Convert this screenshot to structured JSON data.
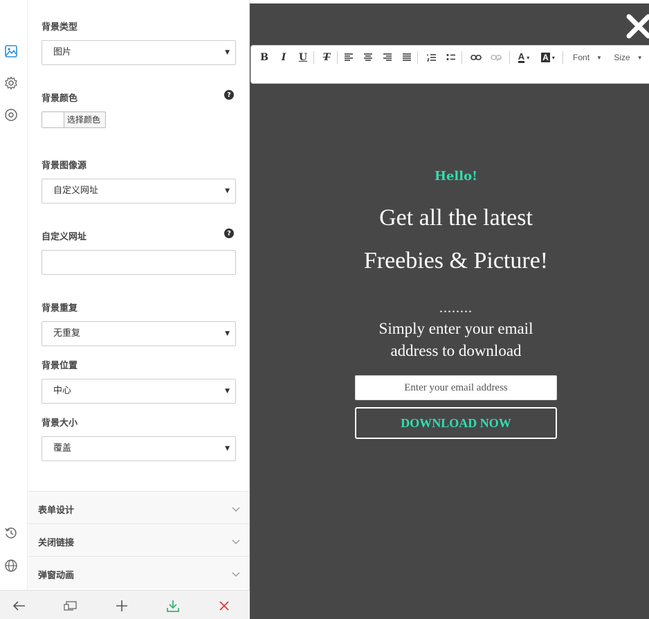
{
  "panel": {
    "bg_type": {
      "label": "背景类型",
      "value": "图片"
    },
    "bg_color": {
      "label": "背景颜色",
      "picker_label": "选择颜色",
      "help": "?"
    },
    "bg_image_source": {
      "label": "背景图像源",
      "value": "自定义网址"
    },
    "custom_url": {
      "label": "自定义网址",
      "value": "",
      "help": "?"
    },
    "bg_repeat": {
      "label": "背景重复",
      "value": "无重复"
    },
    "bg_position": {
      "label": "背景位置",
      "value": "中心"
    },
    "bg_size": {
      "label": "背景大小",
      "value": "覆盖"
    },
    "sections": [
      {
        "title": "表单设计"
      },
      {
        "title": "关闭链接"
      },
      {
        "title": "弹窗动画"
      }
    ]
  },
  "rail_icons": [
    "image-icon",
    "gear-icon",
    "target-icon",
    "history-icon",
    "globe-icon"
  ],
  "bottombar": [
    "back-icon",
    "device-preview-icon",
    "plus-icon",
    "download-icon",
    "close-icon"
  ],
  "editor": {
    "font_label": "Font",
    "size_label": "Size",
    "buttons": {
      "bold": "B",
      "italic": "I",
      "underline": "U",
      "clear": "T",
      "color": "A",
      "bg_color": "A"
    }
  },
  "popup": {
    "hello": "Hello!",
    "headline_line1": "Get all the latest",
    "headline_line2": "Freebies & Picture!",
    "dots": "........",
    "sub_line1": "Simply enter your email",
    "sub_line2": "address to download",
    "email_placeholder": "Enter your email address",
    "button_label": "DOWNLOAD NOW"
  },
  "colors": {
    "accent": "#2fe0b0",
    "preview_bg": "#474747",
    "download_green": "#3cb371",
    "close_red": "#e53935"
  }
}
